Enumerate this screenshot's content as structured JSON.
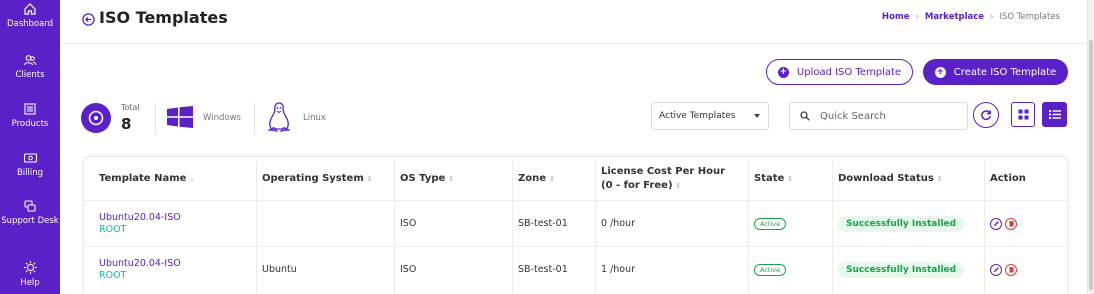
{
  "sidebar": {
    "items": [
      {
        "label": "Dashboard",
        "icon": "home-icon"
      },
      {
        "label": "Clients",
        "icon": "users-icon"
      },
      {
        "label": "Products",
        "icon": "products-icon"
      },
      {
        "label": "Billing",
        "icon": "billing-icon"
      },
      {
        "label": "Support Desk",
        "icon": "support-icon"
      },
      {
        "label": "Help",
        "icon": "help-icon"
      }
    ]
  },
  "header": {
    "title": "ISO Templates",
    "breadcrumb": [
      "Home",
      "Marketplace",
      "ISO Templates"
    ]
  },
  "actions": {
    "upload_label": "Upload ISO Template",
    "create_label": "Create ISO Template"
  },
  "stats": {
    "total_label": "Total",
    "total_value": "8",
    "windows_label": "Windows",
    "linux_label": "Linux"
  },
  "filters": {
    "template_filter": "Active Templates",
    "search_placeholder": "Quick Search"
  },
  "table": {
    "columns": [
      "Template Name",
      "Operating System",
      "OS Type",
      "Zone",
      "License Cost Per Hour (0 - for Free)",
      "State",
      "Download Status",
      "Action"
    ],
    "rows": [
      {
        "name": "Ubuntu20.04-ISO",
        "owner": "ROOT",
        "os": "",
        "os_type": "ISO",
        "zone": "SB-test-01",
        "cost": "0 /hour",
        "state": "Active",
        "download_status": "Successfully Installed"
      },
      {
        "name": "Ubuntu20.04-ISO",
        "owner": "ROOT",
        "os": "Ubuntu",
        "os_type": "ISO",
        "zone": "SB-test-01",
        "cost": "1 /hour",
        "state": "Active",
        "download_status": "Successfully Installed"
      }
    ]
  },
  "colors": {
    "brand": "#5a21c9",
    "owner_teal": "#1ab8a7",
    "success": "#18a34a",
    "delete": "#e03a3a"
  }
}
